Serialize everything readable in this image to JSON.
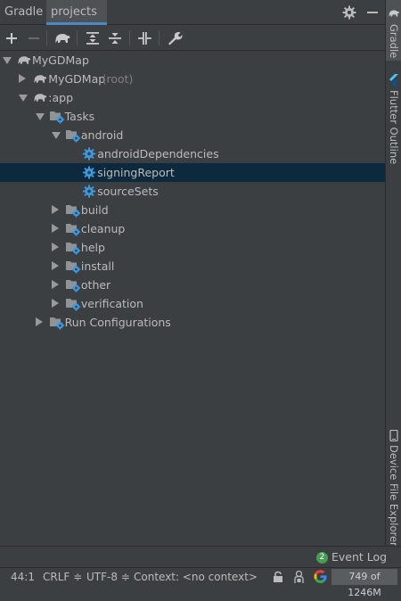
{
  "tabs": [
    {
      "label": "Gradle",
      "active": false
    },
    {
      "label": "projects",
      "active": true
    }
  ],
  "tree": [
    {
      "label": "MyGDMap",
      "suffix": "",
      "icon": "elephant",
      "arrow": "open",
      "depth": 0,
      "selected": false
    },
    {
      "label": "MyGDMap",
      "suffix": "(root)",
      "icon": "elephant",
      "arrow": "closed",
      "depth": 1,
      "selected": false
    },
    {
      "label": ":app",
      "suffix": "",
      "icon": "elephant",
      "arrow": "open",
      "depth": 1,
      "selected": false
    },
    {
      "label": "Tasks",
      "suffix": "",
      "icon": "folder-gear",
      "arrow": "open",
      "depth": 2,
      "selected": false
    },
    {
      "label": "android",
      "suffix": "",
      "icon": "folder-gear",
      "arrow": "open",
      "depth": 3,
      "selected": false
    },
    {
      "label": "androidDependencies",
      "suffix": "",
      "icon": "gear",
      "arrow": "none",
      "depth": 4,
      "selected": false
    },
    {
      "label": "signingReport",
      "suffix": "",
      "icon": "gear",
      "arrow": "none",
      "depth": 4,
      "selected": true
    },
    {
      "label": "sourceSets",
      "suffix": "",
      "icon": "gear",
      "arrow": "none",
      "depth": 4,
      "selected": false
    },
    {
      "label": "build",
      "suffix": "",
      "icon": "folder-gear",
      "arrow": "closed",
      "depth": 3,
      "selected": false
    },
    {
      "label": "cleanup",
      "suffix": "",
      "icon": "folder-gear",
      "arrow": "closed",
      "depth": 3,
      "selected": false
    },
    {
      "label": "help",
      "suffix": "",
      "icon": "folder-gear",
      "arrow": "closed",
      "depth": 3,
      "selected": false
    },
    {
      "label": "install",
      "suffix": "",
      "icon": "folder-gear",
      "arrow": "closed",
      "depth": 3,
      "selected": false
    },
    {
      "label": "other",
      "suffix": "",
      "icon": "folder-gear",
      "arrow": "closed",
      "depth": 3,
      "selected": false
    },
    {
      "label": "verification",
      "suffix": "",
      "icon": "folder-gear",
      "arrow": "closed",
      "depth": 3,
      "selected": false
    },
    {
      "label": "Run Configurations",
      "suffix": "",
      "icon": "folder-gear",
      "arrow": "closed",
      "depth": 2,
      "selected": false
    }
  ],
  "right_tabs": {
    "gradle": "Gradle",
    "flutter": "Flutter Outline",
    "device": "Device File Explorer"
  },
  "event_log": {
    "count": "2",
    "label": "Event Log"
  },
  "status": {
    "position": "44:1",
    "line_sep": "CRLF ≑",
    "encoding": "UTF-8 ≑",
    "context": "Context: <no context>",
    "memory": "749 of 1246M"
  },
  "colors": {
    "background": "#3c3f41",
    "selection": "#0d293e",
    "accent": "#4a88c7",
    "gear_blue": "#3d9ae0",
    "badge_green": "#499c54"
  }
}
